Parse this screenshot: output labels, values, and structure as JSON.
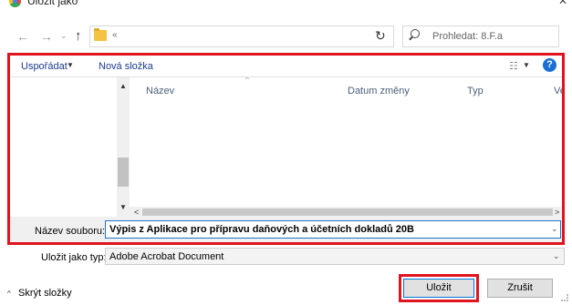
{
  "window": {
    "title": "Uložit jako",
    "close_glyph": "✕"
  },
  "nav": {
    "back_glyph": "←",
    "forward_glyph": "→",
    "history_glyph": "⌄",
    "up_glyph": "↑",
    "breadcrumb": "«",
    "refresh_glyph": "↻",
    "search_placeholder": "Prohledat: 8.F.a"
  },
  "toolbar": {
    "organize_label": "Uspořádat",
    "dropdown_glyph": "▼",
    "new_folder_label": "Nová složka",
    "view_glyph": "☷",
    "help_glyph": "?"
  },
  "file_list": {
    "columns": [
      "Název",
      "Datum změny",
      "Typ",
      "Ve"
    ],
    "sort_glyph": "^",
    "items": [],
    "scroll_glyphs": {
      "up": "▲",
      "down": "▼",
      "left": "<",
      "right": ">"
    }
  },
  "form": {
    "filename_label": "Název souboru:",
    "filename_value": "Výpis z Aplikace pro přípravu daňových a účetních dokladů 20B",
    "type_label": "Uložit jako typ:",
    "type_value": "Adobe Acrobat Document",
    "dropdown_glyph": "⌄"
  },
  "footer": {
    "hide_folders_label": "Skrýt složky",
    "hide_glyph": "^",
    "save_label": "Uložit",
    "cancel_label": "Zrušit"
  },
  "colors": {
    "highlight": "#e0141e",
    "link": "#1b3a8c",
    "help": "#1a6fd4",
    "focus": "#1e73c9"
  }
}
